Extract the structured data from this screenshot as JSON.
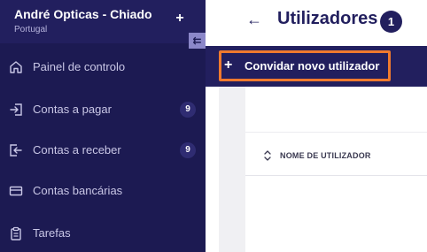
{
  "sidebar": {
    "company_name": "André Opticas - Chiado",
    "company_country": "Portugal",
    "add_symbol": "+",
    "collapse_symbol": "⇇",
    "items": [
      {
        "label": "Painel de controlo",
        "icon": "home-icon",
        "badge": null
      },
      {
        "label": "Contas a pagar",
        "icon": "login-icon",
        "badge": "9"
      },
      {
        "label": "Contas a receber",
        "icon": "logout-icon",
        "badge": "9"
      },
      {
        "label": "Contas bancárias",
        "icon": "card-icon",
        "badge": null
      },
      {
        "label": "Tarefas",
        "icon": "clipboard-icon",
        "badge": null
      }
    ]
  },
  "header": {
    "back_symbol": "←",
    "title": "Utilizadores",
    "step_number": "1"
  },
  "toolbar": {
    "invite_plus": "+",
    "invite_label": "Convidar novo utilizador",
    "highlight_color": "#f07a2e"
  },
  "table": {
    "columns": [
      "NOME DE UTILIZADOR"
    ]
  },
  "colors": {
    "sidebar_bg": "#1c1a52",
    "accent_dark": "#221f5e"
  }
}
